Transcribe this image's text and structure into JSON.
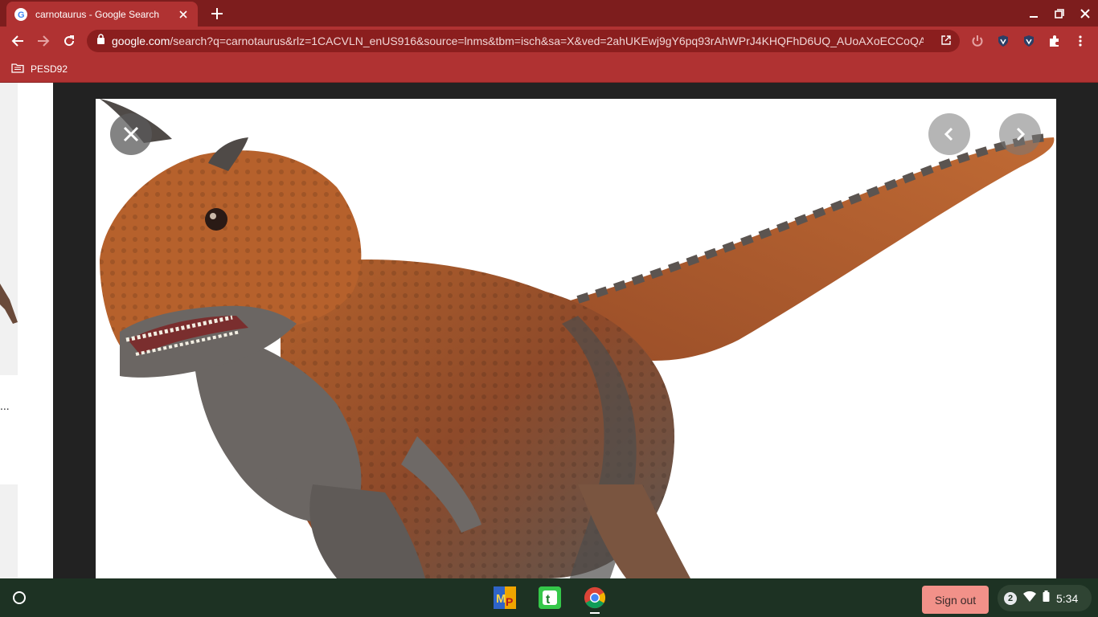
{
  "browser": {
    "tab": {
      "title": "carnotaurus - Google Search"
    },
    "url": {
      "host": "google.com",
      "rest": "/search?q=carnotaurus&rlz=1CACVLN_enUS916&source=lnms&tbm=isch&sa=X&ved=2ahUKEwj9gY6pq93rAhWPrJ4KHQFhD6UQ_AUoAXoECCoQA..."
    },
    "bookmarks": [
      {
        "label": "PESD92"
      }
    ]
  },
  "page": {
    "left_ellipsis": "...",
    "image_subject": "carnotaurus toy figure"
  },
  "shelf": {
    "apps": [
      "mp-app-icon",
      "t-app-icon",
      "chrome-icon"
    ],
    "signout_label": "Sign out",
    "notification_count": "2",
    "time": "5:34"
  },
  "colors": {
    "tabstrip": "#7d1d1d",
    "toolbar": "#b03232",
    "shelf": "#1d3223",
    "signout": "#f29189"
  }
}
